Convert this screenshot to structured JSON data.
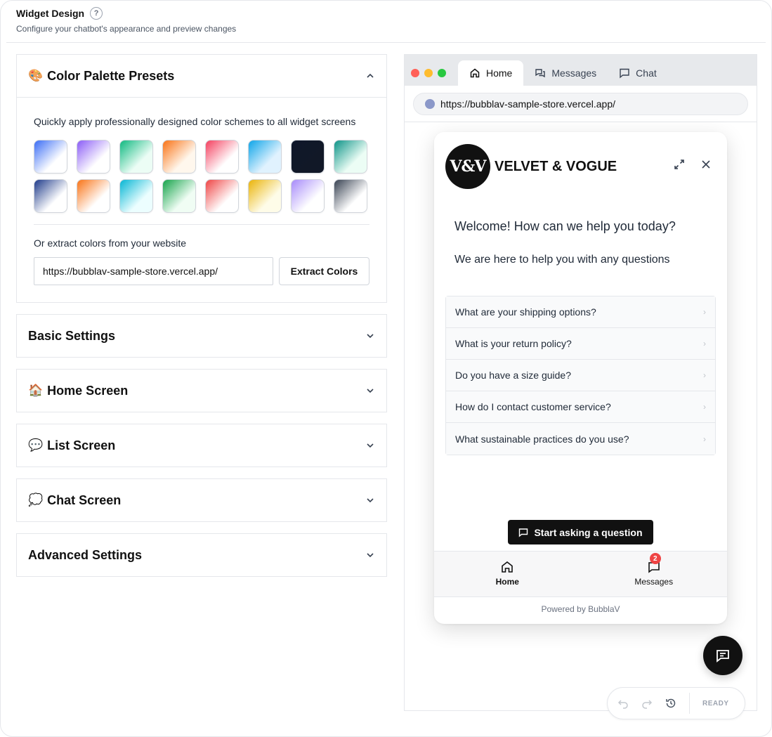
{
  "page": {
    "title": "Widget Design",
    "subtitle": "Configure your chatbot's appearance and preview changes"
  },
  "palette": {
    "title": "Color Palette Presets",
    "emoji": "🎨",
    "description": "Quickly apply professionally designed color schemes to all widget screens",
    "swatches": [
      {
        "from": "#3b6df5",
        "to": "#ffffff"
      },
      {
        "from": "#8b5cf6",
        "to": "#ffffff"
      },
      {
        "from": "#10b981",
        "to": "#ecfdf5"
      },
      {
        "from": "#f97316",
        "to": "#fff7ed"
      },
      {
        "from": "#f43f5e",
        "to": "#ffffff"
      },
      {
        "from": "#0ea5e9",
        "to": "#e0f2fe"
      },
      {
        "from": "#0f172a",
        "to": "#111827"
      },
      {
        "from": "#0d9488",
        "to": "#ecfdf5"
      },
      {
        "from": "#1e3a8a",
        "to": "#ffffff"
      },
      {
        "from": "#f97316",
        "to": "#ffffff"
      },
      {
        "from": "#06b6d4",
        "to": "#ecfeff"
      },
      {
        "from": "#16a34a",
        "to": "#f0fdf4"
      },
      {
        "from": "#ef4444",
        "to": "#ffffff"
      },
      {
        "from": "#eab308",
        "to": "#fefce8"
      },
      {
        "from": "#a78bfa",
        "to": "#ffffff"
      },
      {
        "from": "#374151",
        "to": "#ffffff"
      }
    ],
    "extract_label": "Or extract colors from your website",
    "url_value": "https://bubblav-sample-store.vercel.app/",
    "extract_button": "Extract Colors"
  },
  "sections": [
    {
      "title": "Basic Settings",
      "emoji": ""
    },
    {
      "title": "Home Screen",
      "emoji": "🏠"
    },
    {
      "title": "List Screen",
      "emoji": "💬"
    },
    {
      "title": "Chat Screen",
      "emoji": "💭"
    },
    {
      "title": "Advanced Settings",
      "emoji": ""
    }
  ],
  "browser": {
    "tabs": [
      "Home",
      "Messages",
      "Chat"
    ],
    "url": "https://bubblav-sample-store.vercel.app/"
  },
  "widget": {
    "logo_text": "V&V",
    "brand": "VELVET & VOGUE",
    "welcome_title": "Welcome! How can we help you today?",
    "welcome_sub": "We are here to help you with any questions",
    "faqs": [
      "What are your shipping options?",
      "What is your return policy?",
      "Do you have a size guide?",
      "How do I contact customer service?",
      "What sustainable practices do you use?"
    ],
    "ask_button": "Start asking a question",
    "nav": {
      "home": "Home",
      "messages": "Messages",
      "badge": "2"
    },
    "powered_by": "Powered by BubblaV"
  },
  "toolbar": {
    "status": "READY"
  },
  "colors": {
    "accent": "#111111",
    "badge": "#ef4444"
  }
}
